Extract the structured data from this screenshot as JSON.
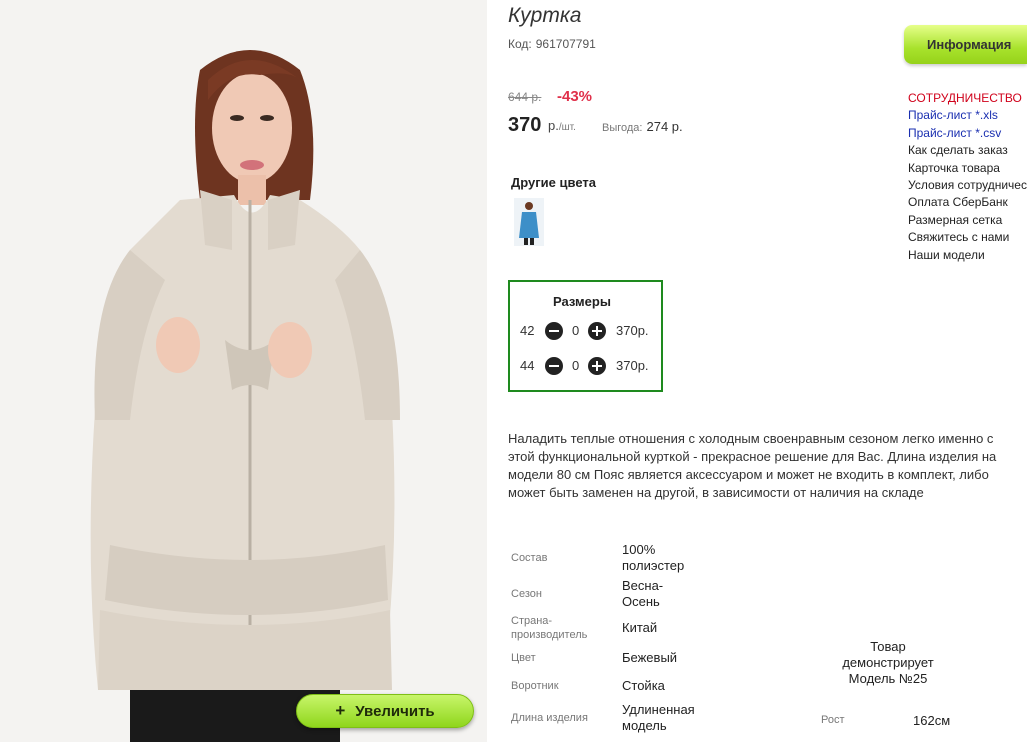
{
  "product": {
    "title": "Куртка",
    "code_label": "Код:",
    "code": "961707791",
    "old_price": "644 р.",
    "discount": "-43%",
    "price": "370",
    "price_currency": "р.",
    "price_per": "/шт.",
    "benefit_label": "Выгода:",
    "benefit_value": "274 р."
  },
  "zoom_button": {
    "icon": "+",
    "label": "Увеличить"
  },
  "other_colors": {
    "title": "Другие цвета",
    "swatch_icon": "blue-jacket-thumbnail"
  },
  "sizes": {
    "title": "Размеры",
    "rows": [
      {
        "size": "42",
        "qty": "0",
        "price": "370р."
      },
      {
        "size": "44",
        "qty": "0",
        "price": "370р."
      }
    ]
  },
  "description": "Наладить теплые отношения с холодным своенравным сезоном легко именно с этой функциональной курткой - прекрасное решение для Вас. Длина изделия на модели 80 см Пояс является аксессуаром и может не входить в комплект, либо может быть заменен на другой, в зависимости от наличия на складе",
  "specs": [
    {
      "label": "Состав",
      "value": "100% полиэстер"
    },
    {
      "label": "Сезон",
      "value": "Весна-Осень"
    },
    {
      "label": "Страна-производитель",
      "value": "Китай"
    },
    {
      "label": "Цвет",
      "value": "Бежевый"
    },
    {
      "label": "Воротник",
      "value": "Стойка"
    },
    {
      "label": "Длина изделия",
      "value": "Удлиненная модель"
    }
  ],
  "model_note": "Товар демонстрирует Модель №25",
  "model_height": {
    "label": "Рост",
    "value": "162см"
  },
  "sidebar": {
    "info_button": "Информация",
    "links": [
      {
        "label": "СОТРУДНИЧЕСТВО"
      },
      {
        "label": "Прайс-лист *.xls"
      },
      {
        "label": "Прайс-лист *.csv"
      },
      {
        "label": "Как сделать заказ"
      },
      {
        "label": "Карточка товара"
      },
      {
        "label": "Условия сотрудничества"
      },
      {
        "label": "Оплата СберБанк"
      },
      {
        "label": "Размерная сетка"
      },
      {
        "label": "Свяжитесь с нами"
      },
      {
        "label": "Наши модели"
      }
    ]
  },
  "colors": {
    "accent_green": "#9ad91f",
    "sizes_border": "#1e8a1e",
    "discount_red": "#e0304a",
    "link_blue": "#1a2fb0",
    "link_red": "#d0021b"
  }
}
